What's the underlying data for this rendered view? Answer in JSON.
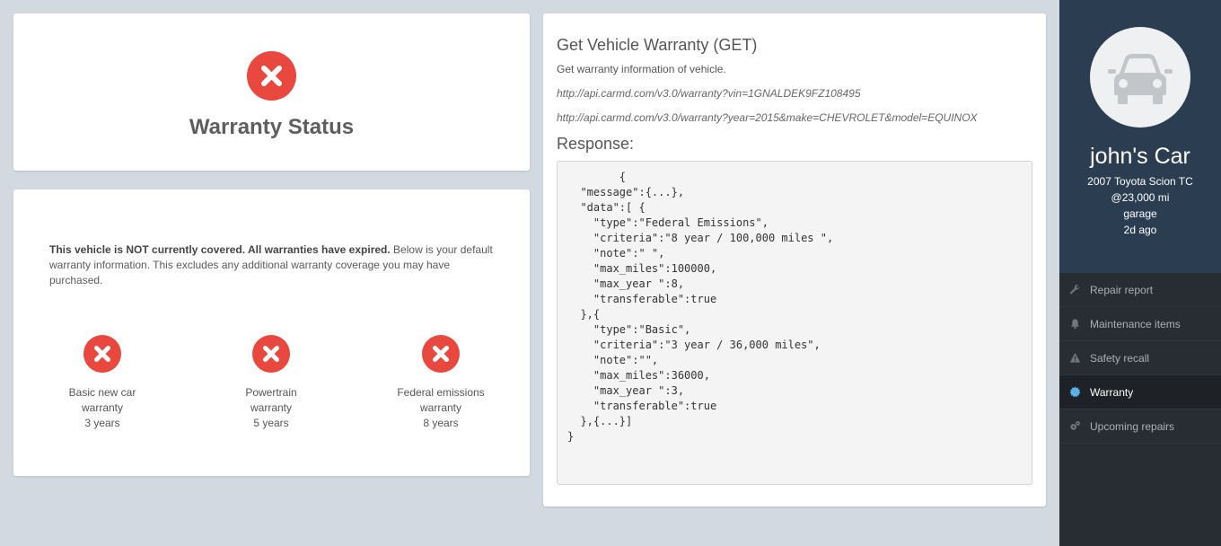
{
  "status_card": {
    "title": "Warranty Status",
    "icon": "error-x-icon",
    "icon_color": "#e8483e"
  },
  "coverage_card": {
    "notice_bold": "This vehicle is NOT currently covered. All warranties have expired.",
    "notice_rest": " Below is your default warranty information. This excludes any additional warranty coverage you may have purchased.",
    "warranties": [
      {
        "line1": "Basic new car",
        "line2": "warranty",
        "duration": "3 years"
      },
      {
        "line1": "Powertrain",
        "line2": "warranty",
        "duration": "5 years"
      },
      {
        "line1": "Federal emissions",
        "line2": "warranty",
        "duration": "8 years"
      }
    ]
  },
  "api_card": {
    "title": "Get Vehicle Warranty (GET)",
    "description": "Get warranty information of vehicle.",
    "url_vin": "http://api.carmd.com/v3.0/warranty?vin=1GNALDEK9FZ108495",
    "url_ymm": "http://api.carmd.com/v3.0/warranty?year=2015&make=CHEVROLET&model=EQUINOX",
    "response_label": "Response:",
    "response_code": "        {\n  \"message\":{...},\n  \"data\":[ {\n    \"type\":\"Federal Emissions\",\n    \"criteria\":\"8 year / 100,000 miles \",\n    \"note\":\" \",\n    \"max_miles\":100000,\n    \"max_year \":8,\n    \"transferable\":true\n  },{\n    \"type\":\"Basic\",\n    \"criteria\":\"3 year / 36,000 miles\",\n    \"note\":\"\",\n    \"max_miles\":36000,\n    \"max_year \":3,\n    \"transferable\":true\n  },{...}]\n}"
  },
  "sidebar": {
    "car_name": "john's Car",
    "car_model": "2007 Toyota Scion TC",
    "mileage": "@23,000 mi",
    "location": "garage",
    "updated": "2d ago",
    "menu": [
      {
        "label": "Repair report",
        "icon": "wrench-icon"
      },
      {
        "label": "Maintenance items",
        "icon": "bell-icon"
      },
      {
        "label": "Safety recall",
        "icon": "warning-icon"
      },
      {
        "label": "Warranty",
        "icon": "badge-icon",
        "active": true
      },
      {
        "label": "Upcoming repairs",
        "icon": "gears-icon"
      }
    ],
    "colors": {
      "header_bg": "#2b3e51",
      "menu_bg": "#272d33",
      "active_bg": "#1e2226",
      "badge_icon": "#5ab0e8"
    }
  }
}
